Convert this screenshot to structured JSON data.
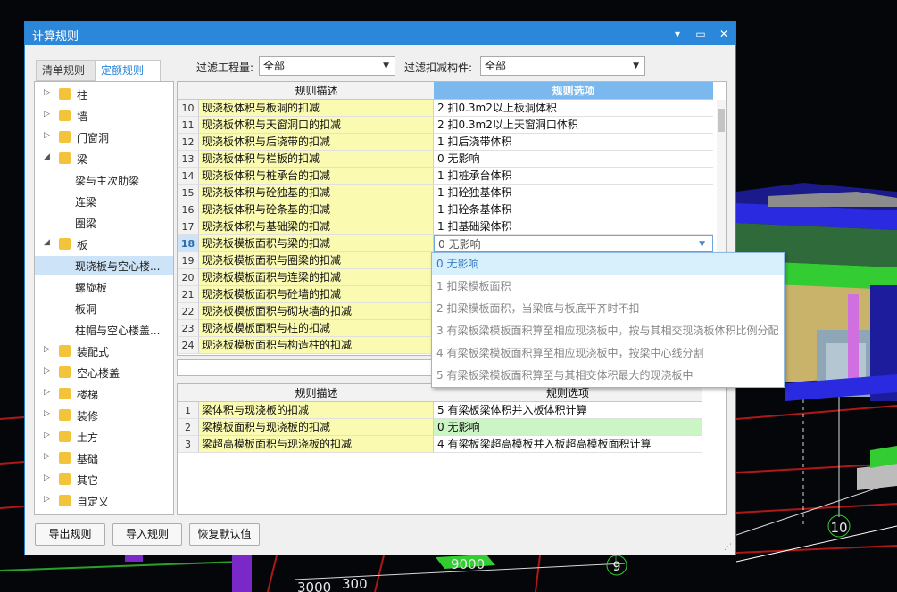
{
  "window": {
    "title": "计算规则",
    "buttons": [
      "▾",
      "▭",
      "✕"
    ]
  },
  "tabs": [
    {
      "label": "清单规则",
      "active": false
    },
    {
      "label": "定额规则",
      "active": true
    }
  ],
  "filters": {
    "quantity_label": "过滤工程量:",
    "quantity_value": "全部",
    "deduct_label": "过滤扣减构件:",
    "deduct_value": "全部"
  },
  "tree": [
    {
      "label": "柱",
      "type": "folder",
      "expanded": false
    },
    {
      "label": "墙",
      "type": "folder",
      "expanded": false
    },
    {
      "label": "门窗洞",
      "type": "folder",
      "expanded": false
    },
    {
      "label": "梁",
      "type": "folder",
      "expanded": true
    },
    {
      "label": "梁与主次肋梁",
      "type": "leaf"
    },
    {
      "label": "连梁",
      "type": "leaf"
    },
    {
      "label": "圈梁",
      "type": "leaf"
    },
    {
      "label": "板",
      "type": "folder",
      "expanded": true
    },
    {
      "label": "现浇板与空心楼...",
      "type": "leaf",
      "selected": true
    },
    {
      "label": "螺旋板",
      "type": "leaf"
    },
    {
      "label": "板洞",
      "type": "leaf"
    },
    {
      "label": "柱帽与空心楼盖...",
      "type": "leaf"
    },
    {
      "label": "装配式",
      "type": "folder",
      "expanded": false
    },
    {
      "label": "空心楼盖",
      "type": "folder",
      "expanded": false
    },
    {
      "label": "楼梯",
      "type": "folder",
      "expanded": false
    },
    {
      "label": "装修",
      "type": "folder",
      "expanded": false
    },
    {
      "label": "土方",
      "type": "folder",
      "expanded": false
    },
    {
      "label": "基础",
      "type": "folder",
      "expanded": false
    },
    {
      "label": "其它",
      "type": "folder",
      "expanded": false
    },
    {
      "label": "自定义",
      "type": "folder",
      "expanded": false
    }
  ],
  "grid_main": {
    "headers": [
      "规则描述",
      "规则选项"
    ],
    "rows": [
      {
        "num": "10",
        "desc": "现浇板体积与板洞的扣减",
        "val": "2  扣0.3m2以上板洞体积"
      },
      {
        "num": "11",
        "desc": "现浇板体积与天窗洞口的扣减",
        "val": "2  扣0.3m2以上天窗洞口体积"
      },
      {
        "num": "12",
        "desc": "现浇板体积与后浇带的扣减",
        "val": "1  扣后浇带体积"
      },
      {
        "num": "13",
        "desc": "现浇板体积与栏板的扣减",
        "val": "0  无影响"
      },
      {
        "num": "14",
        "desc": "现浇板体积与桩承台的扣减",
        "val": "1  扣桩承台体积"
      },
      {
        "num": "15",
        "desc": "现浇板体积与砼独基的扣减",
        "val": "1  扣砼独基体积"
      },
      {
        "num": "16",
        "desc": "现浇板体积与砼条基的扣减",
        "val": "1  扣砼条基体积"
      },
      {
        "num": "17",
        "desc": "现浇板体积与基础梁的扣减",
        "val": "1  扣基础梁体积"
      },
      {
        "num": "18",
        "desc": "现浇板模板面积与梁的扣减",
        "val": "0  无影响",
        "current": true
      },
      {
        "num": "19",
        "desc": "现浇板模板面积与圈梁的扣减",
        "val": ""
      },
      {
        "num": "20",
        "desc": "现浇板模板面积与连梁的扣减",
        "val": ""
      },
      {
        "num": "21",
        "desc": "现浇板模板面积与砼墙的扣减",
        "val": ""
      },
      {
        "num": "22",
        "desc": "现浇板模板面积与砌块墙的扣减",
        "val": ""
      },
      {
        "num": "23",
        "desc": "现浇板模板面积与柱的扣减",
        "val": ""
      },
      {
        "num": "24",
        "desc": "现浇板模板面积与构造柱的扣减",
        "val": ""
      }
    ]
  },
  "dropdown": {
    "items": [
      {
        "label": "0  无影响",
        "highlighted": true
      },
      {
        "label": "1  扣梁模板面积"
      },
      {
        "label": "2  扣梁模板面积，当梁底与板底平齐时不扣"
      },
      {
        "label": "3  有梁板梁模板面积算至相应现浇板中，按与其相交现浇板体积比例分配"
      },
      {
        "label": "4  有梁板梁模板面积算至相应现浇板中，按梁中心线分割"
      },
      {
        "label": "5  有梁板梁模板面积算至与其相交体积最大的现浇板中"
      }
    ]
  },
  "grid_sub": {
    "headers": [
      "规则描述",
      "规则选项"
    ],
    "rows": [
      {
        "num": "1",
        "desc": "梁体积与现浇板的扣减",
        "val": "5 有梁板梁体积并入板体积计算",
        "green": false
      },
      {
        "num": "2",
        "desc": "梁模板面积与现浇板的扣减",
        "val": "0  无影响",
        "green": true
      },
      {
        "num": "3",
        "desc": "梁超高模板面积与现浇板的扣减",
        "val": "4 有梁板梁超高模板并入板超高模板面积计算",
        "green": false
      }
    ]
  },
  "buttons": {
    "export": "导出规则",
    "import": "导入规则",
    "reset": "恢复默认值"
  },
  "background": {
    "dims": [
      "9000",
      "3000",
      "300"
    ],
    "axis_labels": [
      "10",
      "9"
    ]
  }
}
